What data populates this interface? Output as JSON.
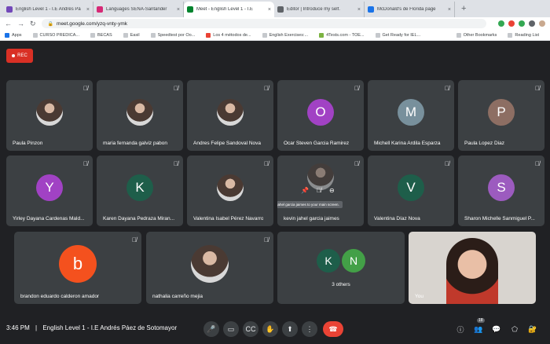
{
  "browser": {
    "tabs": [
      {
        "title": "English Level 1 - I.E Andrés Pá",
        "favicon_color": "#7248b9",
        "active": false
      },
      {
        "title": "Languages SENA-Santander",
        "favicon_color": "#d62976",
        "active": false
      },
      {
        "title": "Meet - English Level 1 - I.E",
        "favicon_color": "#00832d",
        "active": true
      },
      {
        "title": "Editor | Introduce my self.",
        "favicon_color": "#5f6368",
        "active": false
      },
      {
        "title": "McDonald's de Florida page",
        "favicon_color": "#1a73e8",
        "active": false
      }
    ],
    "close_glyph": "×",
    "new_tab_glyph": "+",
    "url": "meet.google.com/yzq-vnty-ymk",
    "bookmarks": [
      {
        "label": "Apps"
      },
      {
        "label": "CURSO PREDICA..."
      },
      {
        "label": "BECAS"
      },
      {
        "label": "Easil"
      },
      {
        "label": "Speedtest por Oo..."
      },
      {
        "label": "Los 4 métodos de..."
      },
      {
        "label": "English Exercises:..."
      },
      {
        "label": "4Tests.com - TOE..."
      },
      {
        "label": "Get Ready for IEL..."
      }
    ],
    "bookmarks_right": [
      {
        "label": "Other Bookmarks"
      },
      {
        "label": "Reading List"
      }
    ]
  },
  "meet": {
    "rec_label": "REC",
    "tiles": [
      {
        "name": "Paula Pinzon",
        "initial": "",
        "color": "",
        "photo": true
      },
      {
        "name": "maria fernanda galviz pabon",
        "initial": "",
        "color": "",
        "photo": true
      },
      {
        "name": "Andres Felipe Sandoval Nova",
        "initial": "",
        "color": "",
        "photo": true
      },
      {
        "name": "Ocar Steven Garcia Ramirez",
        "initial": "O",
        "color": "#a142c4",
        "photo": false
      },
      {
        "name": "Michell Karina Ardila Esparza",
        "initial": "M",
        "color": "#78909c",
        "photo": false
      },
      {
        "name": "Paula Lopez Diaz",
        "initial": "P",
        "color": "#8d6e63",
        "photo": false
      },
      {
        "name": "Yirley Dayana Cardenas Mald...",
        "initial": "Y",
        "color": "#a142c4",
        "photo": false
      },
      {
        "name": "Karen Dayana Pedraza Miran...",
        "initial": "K",
        "color": "#1e5e4a",
        "photo": false
      },
      {
        "name": "Valentina Isabel Pérez Navarro",
        "initial": "",
        "color": "",
        "photo": true
      },
      {
        "name": "kevin jahel garcia jaimes",
        "initial": "",
        "color": "",
        "photo": true
      },
      {
        "name": "Valentina Díaz Nova",
        "initial": "V",
        "color": "#1e5e4a",
        "photo": false
      },
      {
        "name": "Sharon Michelle Sanmiguel P...",
        "initial": "S",
        "color": "#9c5bbf",
        "photo": false
      },
      {
        "name": "brandon eduardo calderon amador",
        "initial": "b",
        "color": "#f4511e",
        "photo": false
      },
      {
        "name": "nathalia carreño mejia",
        "initial": "",
        "color": "",
        "photo": true
      }
    ],
    "others": {
      "label": "3 others",
      "initials": [
        {
          "letter": "K",
          "color": "#1e5e4a"
        },
        {
          "letter": "N",
          "color": "#43a047"
        }
      ]
    },
    "self_label": "You",
    "tooltip": "Pin kevin jahel garcia jaimes to your main screen.",
    "clock": "3:46 PM",
    "separator": "|",
    "meeting_title": "English Level 1 - I.E Andrés Páez de Sotomayor",
    "participants_count": "18"
  }
}
